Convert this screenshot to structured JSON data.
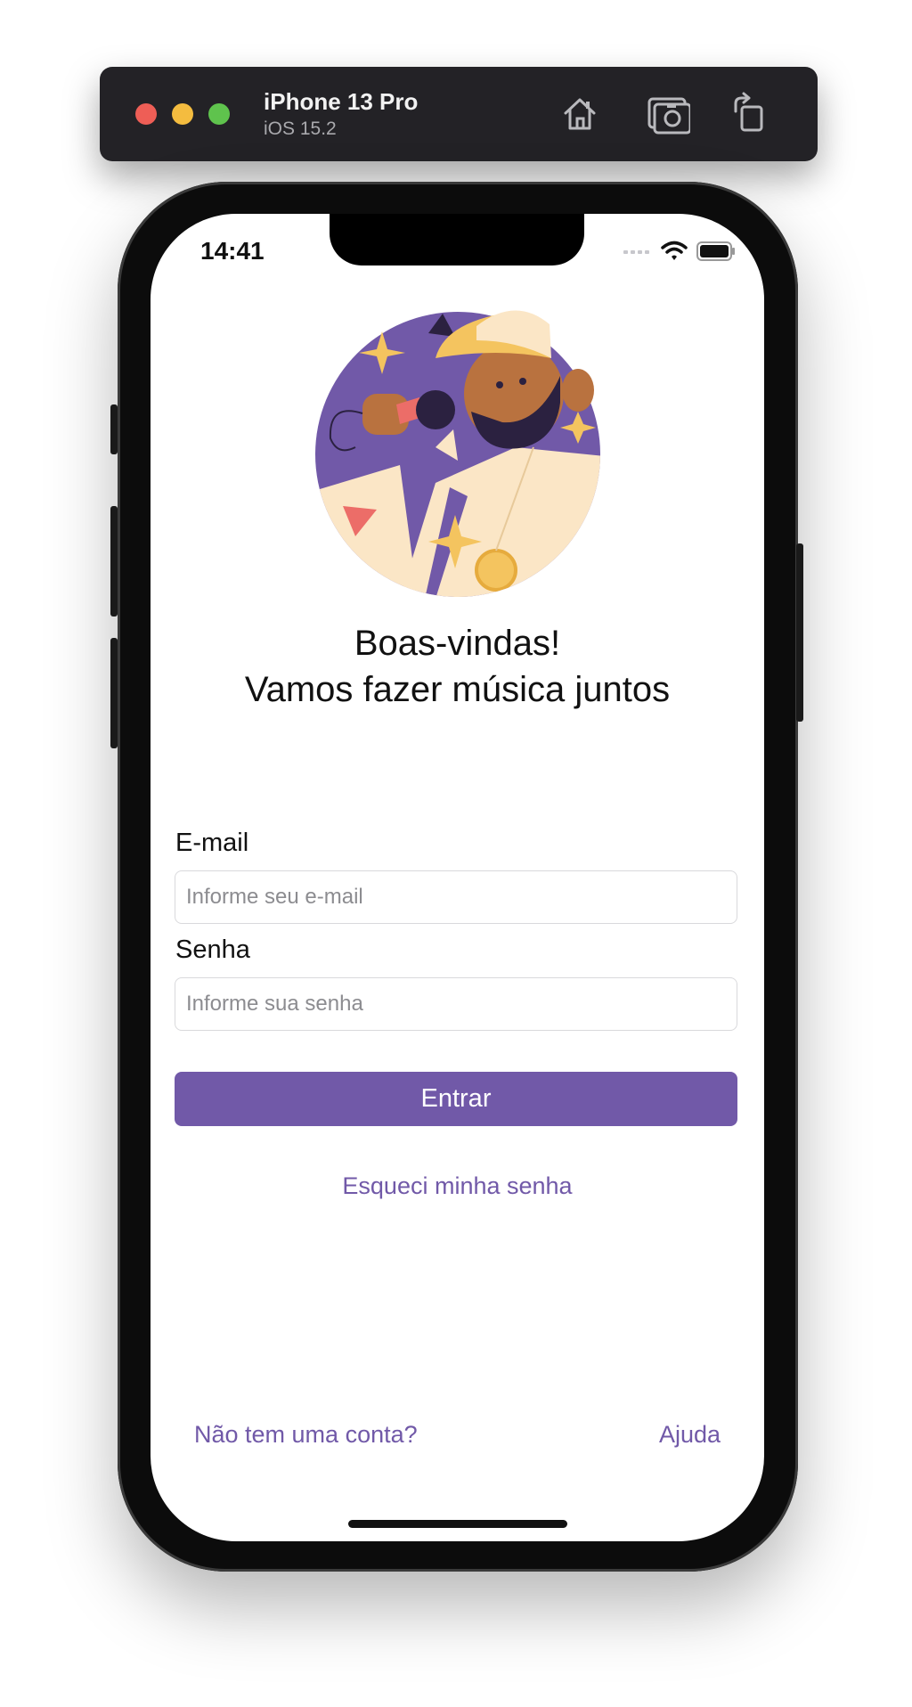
{
  "simulator": {
    "device_name": "iPhone 13 Pro",
    "os_version": "iOS 15.2",
    "buttons": [
      "home-icon",
      "screenshot-icon",
      "rotate-icon"
    ]
  },
  "status_bar": {
    "time": "14:41"
  },
  "welcome": {
    "line1": "Boas-vindas!",
    "line2": "Vamos fazer música juntos"
  },
  "form": {
    "email_label": "E-mail",
    "email_placeholder": "Informe seu e-mail",
    "password_label": "Senha",
    "password_placeholder": "Informe sua senha",
    "submit_label": "Entrar",
    "forgot_label": "Esqueci minha senha"
  },
  "footer": {
    "signup_label": "Não tem uma conta?",
    "help_label": "Ajuda"
  },
  "colors": {
    "accent": "#7159a8",
    "illustration_purple": "#7159a8",
    "illustration_cream": "#fbe6c6",
    "illustration_yellow": "#f4c45f"
  }
}
